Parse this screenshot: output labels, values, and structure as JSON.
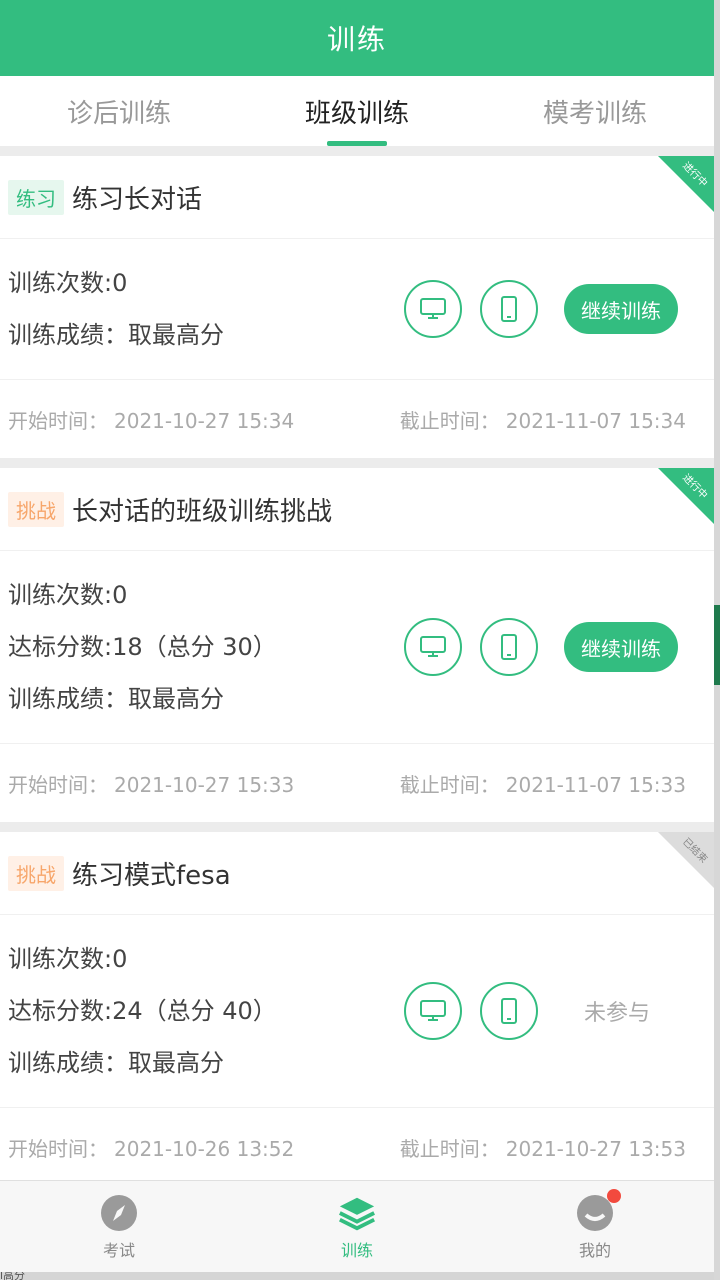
{
  "header": {
    "title": "训练"
  },
  "tabs": [
    {
      "label": "诊后训练",
      "active": false
    },
    {
      "label": "班级训练",
      "active": true
    },
    {
      "label": "模考训练",
      "active": false
    }
  ],
  "cards": [
    {
      "tag": "练习",
      "title": "练习长对话",
      "corner": "进行中",
      "lines": [
        "训练次数:0",
        "训练成绩：取最高分"
      ],
      "action": "继续训练",
      "start_label": "开始时间：",
      "start": "2021-10-27 15:34",
      "end_label": "截止时间：",
      "end": "2021-11-07 15:34"
    },
    {
      "tag": "挑战",
      "title": "长对话的班级训练挑战",
      "corner": "进行中",
      "lines": [
        "训练次数:0",
        "达标分数:18（总分 30）",
        "训练成绩：取最高分"
      ],
      "action": "继续训练",
      "start_label": "开始时间：",
      "start": "2021-10-27 15:33",
      "end_label": "截止时间：",
      "end": "2021-11-07 15:33"
    },
    {
      "tag": "挑战",
      "title": "练习模式fesa",
      "corner": "已结束",
      "lines": [
        "训练次数:0",
        "达标分数:24（总分 40）",
        "训练成绩：取最高分"
      ],
      "status": "未参与",
      "start_label": "开始时间：",
      "start": "2021-10-26 13:52",
      "end_label": "截止时间：",
      "end": "2021-10-27 13:53"
    }
  ],
  "bottom_nav": [
    {
      "label": "考试",
      "icon": "compass-icon"
    },
    {
      "label": "训练",
      "icon": "layers-icon",
      "active": true
    },
    {
      "label": "我的",
      "icon": "profile-icon",
      "badge": true
    }
  ],
  "bottom_strip_text": "l高分",
  "colors": {
    "accent": "#33bd80",
    "challenge_tag": "#f7a66b",
    "badge": "#f24a3e"
  }
}
